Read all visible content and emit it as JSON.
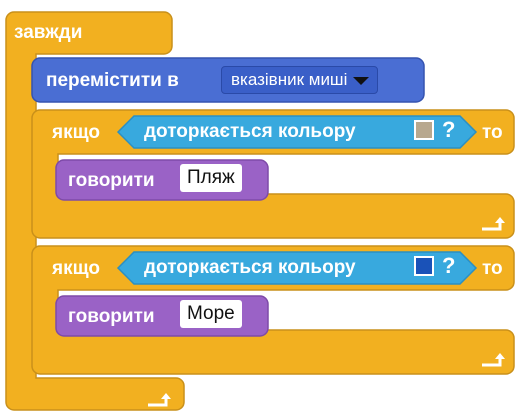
{
  "forever": {
    "label": "завжди"
  },
  "move": {
    "label": "перемістити в",
    "target": "вказівник миші"
  },
  "if_blocks": [
    {
      "if_label": "якщо",
      "condition": "доторкається кольору",
      "color": "#b8a88e",
      "question": "?",
      "then_label": "то",
      "say": {
        "label": "говорити",
        "text": "Пляж"
      }
    },
    {
      "if_label": "якщо",
      "condition": "доторкається кольору",
      "color": "#1a52b8",
      "question": "?",
      "then_label": "то",
      "say": {
        "label": "говорити",
        "text": "Море"
      }
    }
  ],
  "colors": {
    "control": "#f2b020",
    "control_edge": "#c9901a",
    "motion": "#4a6ed3",
    "sensing": "#38a9de",
    "looks": "#9a62c6"
  },
  "icons": [
    "loop-arrow-icon",
    "dropdown-arrow-icon"
  ]
}
